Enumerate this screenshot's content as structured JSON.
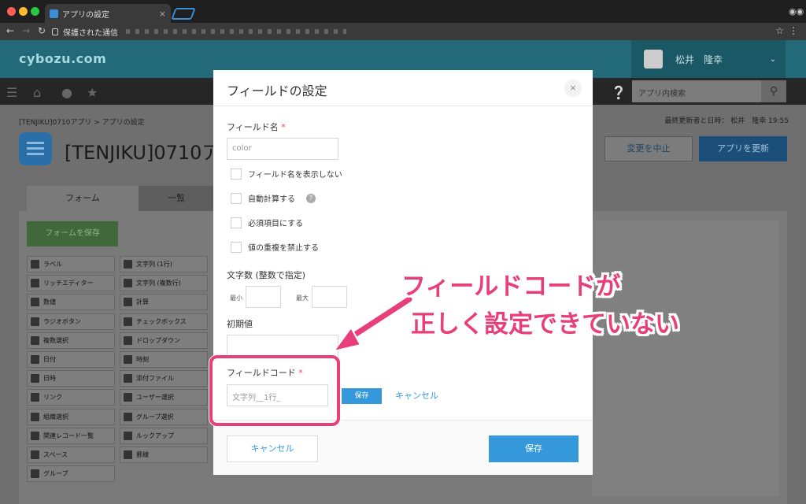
{
  "browser": {
    "tab_title": "アプリの設定",
    "tab_close": "×",
    "address_secure": "保護された通信",
    "icons": [
      "back-icon",
      "forward-icon",
      "reload-icon",
      "lock-icon",
      "star-icon",
      "menu-icon",
      "incognito-icon"
    ]
  },
  "header": {
    "logo": "cybozu.com",
    "user_name": "松井　隆幸",
    "search_placeholder": "アプリ内検索"
  },
  "page": {
    "breadcrumb": "[TENJIKU]0710アプリ  >  アプリの設定",
    "last_updated": "最終更新者と日時：  松井　隆幸  19:55",
    "app_title": "[TENJIKU]0710ア",
    "btn_stop": "変更を中止",
    "btn_update": "アプリを更新",
    "tab_form": "フォーム",
    "tab_list": "一覧",
    "save_form": "フォームを保存"
  },
  "palette": [
    "ラベル",
    "文字列 (1行)",
    "リッチエディター",
    "文字列 (複数行)",
    "数値",
    "計算",
    "ラジオボタン",
    "チェックボックス",
    "複数選択",
    "ドロップダウン",
    "日付",
    "時刻",
    "日時",
    "添付ファイル",
    "リンク",
    "ユーザー選択",
    "組織選択",
    "グループ選択",
    "関連レコード一覧",
    "ルックアップ",
    "スペース",
    "罫線",
    "グループ",
    ""
  ],
  "modal": {
    "title": "フィールドの設定",
    "close": "×",
    "field_name_label": "フィールド名",
    "required_mark": "*",
    "field_name_value": "color",
    "checkboxes": [
      "フィールド名を表示しない",
      "自動計算する",
      "必須項目にする",
      "値の重複を禁止する"
    ],
    "help": "?",
    "char_count_label": "文字数 (整数で指定)",
    "min_label": "最小",
    "max_label": "最大",
    "default_label": "初期値",
    "field_code_label": "フィールドコード",
    "field_code_value": "文字列__1行_",
    "code_save": "保存",
    "code_cancel": "キャンセル",
    "footer_cancel": "キャンセル",
    "footer_save": "保存"
  },
  "annotation": {
    "line1": "フィールドコードが",
    "line2": "正しく設定できていない",
    "color": "#e83e7a"
  }
}
